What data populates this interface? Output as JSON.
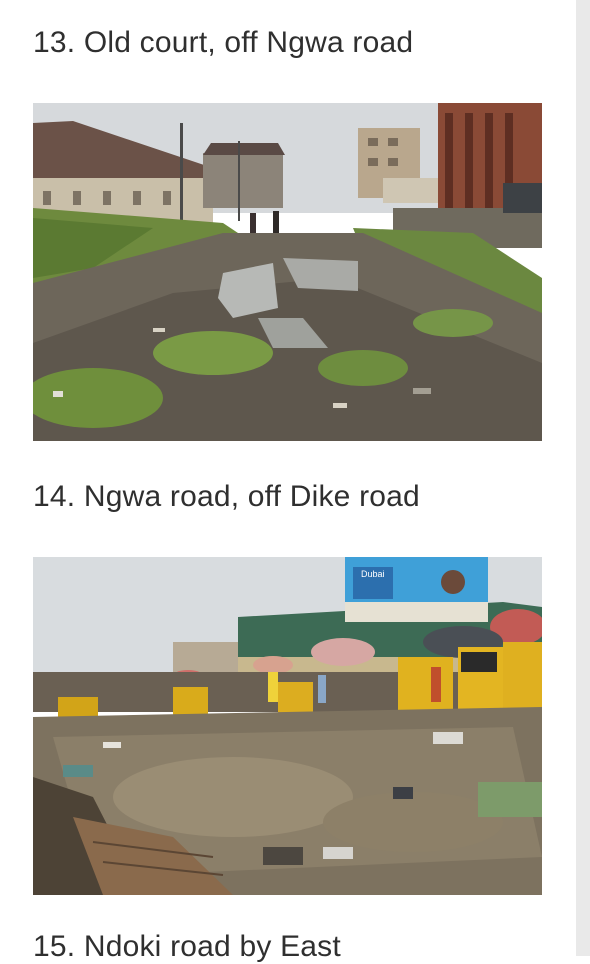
{
  "article": {
    "items": [
      {
        "heading": "13. Old court, off Ngwa road"
      },
      {
        "heading": "14. Ngwa road, off Dike road",
        "billboard_text": "Dubai"
      },
      {
        "heading": "15. Ndoki road by East"
      }
    ]
  },
  "colors": {
    "heading_text": "#2f2f2f",
    "background": "#ffffff",
    "scrollbar_track": "#e9e9e9"
  }
}
